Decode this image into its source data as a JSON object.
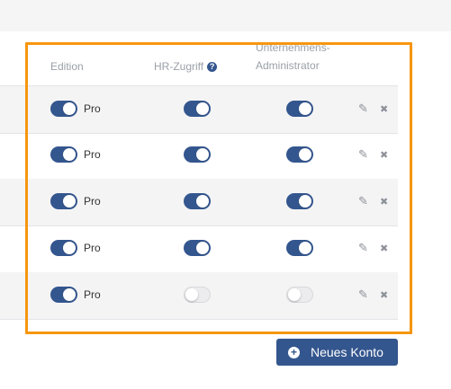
{
  "columns": {
    "edition": "Edition",
    "hr_access": "HR-Zugriff",
    "company_admin_line1": "Unternehmens-",
    "company_admin_line2": "Administrator"
  },
  "help_icon": "?",
  "rows": [
    {
      "edition_on": true,
      "edition_label": "Pro",
      "hr_on": true,
      "admin_on": true
    },
    {
      "edition_on": true,
      "edition_label": "Pro",
      "hr_on": true,
      "admin_on": true
    },
    {
      "edition_on": true,
      "edition_label": "Pro",
      "hr_on": true,
      "admin_on": true
    },
    {
      "edition_on": true,
      "edition_label": "Pro",
      "hr_on": true,
      "admin_on": true
    },
    {
      "edition_on": true,
      "edition_label": "Pro",
      "hr_on": false,
      "admin_on": false
    }
  ],
  "actions": {
    "edit_icon": "✎",
    "delete_icon": "✖"
  },
  "new_account": {
    "label": "Neues Konto",
    "icon": "+"
  },
  "colors": {
    "accent": "#34568e",
    "highlight": "#f7960f"
  }
}
